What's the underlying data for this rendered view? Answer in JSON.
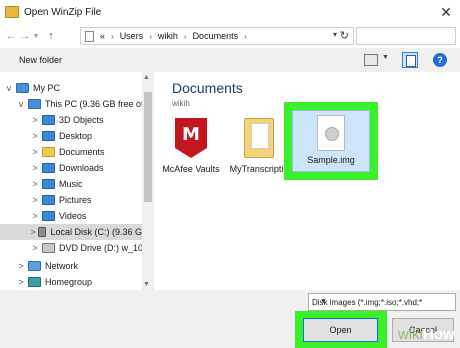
{
  "window": {
    "title": "Open WinZip File"
  },
  "nav": {
    "back_icon": "arrow-left-icon",
    "forward_icon": "arrow-right-icon",
    "up_icon": "arrow-up-icon"
  },
  "address": {
    "parts": [
      "Users",
      "wikih",
      "Documents"
    ],
    "leading": "«"
  },
  "toolbar": {
    "new_folder": "New folder",
    "help": "?"
  },
  "tree": {
    "items": [
      {
        "label": "My PC",
        "icon": "computer-icon",
        "chevron": "v"
      },
      {
        "label": "This PC (9.36 GB free of",
        "icon": "computer-icon",
        "chevron": "v"
      },
      {
        "label": "3D Objects",
        "icon": "folder-icon",
        "chevron": ">"
      },
      {
        "label": "Desktop",
        "icon": "folder-icon",
        "chevron": ">"
      },
      {
        "label": "Documents",
        "icon": "folder-icon",
        "chevron": ">"
      },
      {
        "label": "Downloads",
        "icon": "download-folder-icon",
        "chevron": ">"
      },
      {
        "label": "Music",
        "icon": "music-folder-icon",
        "chevron": ">"
      },
      {
        "label": "Pictures",
        "icon": "pictures-folder-icon",
        "chevron": ">"
      },
      {
        "label": "Videos",
        "icon": "videos-folder-icon",
        "chevron": ">"
      },
      {
        "label": "Local Disk (C:) (9.36 G",
        "icon": "disk-icon",
        "chevron": ">"
      },
      {
        "label": "DVD Drive (D:) w_10_",
        "icon": "dvd-icon",
        "chevron": ">"
      },
      {
        "label": "Network",
        "icon": "network-icon",
        "chevron": ">"
      },
      {
        "label": "Homegroup",
        "icon": "homegroup-icon",
        "chevron": ">"
      }
    ]
  },
  "main": {
    "folder_title": "Documents",
    "folder_sub": "wikih",
    "files": [
      {
        "label": "McAfee Vaults"
      },
      {
        "label": "MyTranscriptio"
      },
      {
        "label": "Sample.img"
      }
    ]
  },
  "footer": {
    "file_type": "Disk images (*.img;*.iso;*.vhd;*",
    "open": "Open",
    "cancel": "Cancel"
  },
  "watermark": {
    "wiki": "wiki",
    "how": "How"
  },
  "colors": {
    "highlight": "#39f029",
    "accent": "#0078d7"
  }
}
